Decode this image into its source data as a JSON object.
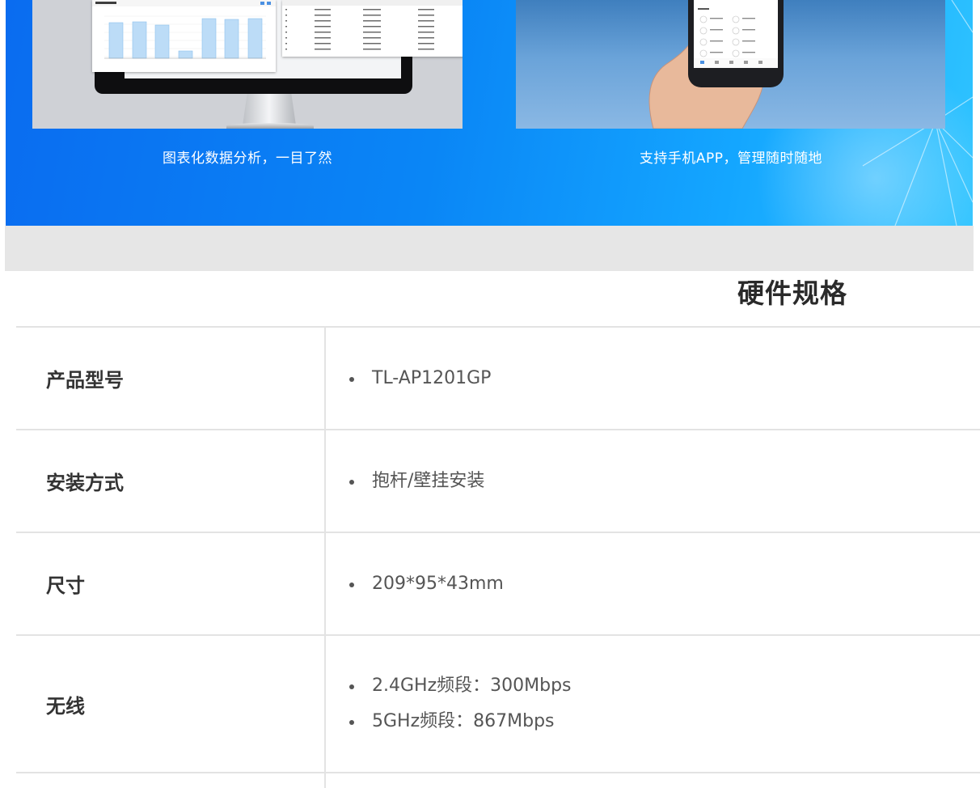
{
  "banner": {
    "left_caption": "图表化数据分析，一目了然",
    "right_caption": "支持手机APP，管理随时随地",
    "colors": {
      "gradient_start": "#0a6cf0",
      "gradient_end": "#2fc4ff",
      "caption": "#ffffff"
    }
  },
  "spec": {
    "title": "硬件规格",
    "rows": [
      {
        "label": "产品型号",
        "values": [
          "TL-AP1201GP"
        ]
      },
      {
        "label": "安装方式",
        "values": [
          "抱杆/壁挂安装"
        ]
      },
      {
        "label": "尺寸",
        "values": [
          "209*95*43mm"
        ]
      },
      {
        "label": "无线",
        "values": [
          "2.4GHz频段：300Mbps",
          "5GHz频段：867Mbps"
        ]
      }
    ]
  },
  "colors": {
    "strip": "#e6e6e6",
    "divider": "#e3e3e3",
    "label_text": "#333333",
    "value_text": "#555555"
  }
}
